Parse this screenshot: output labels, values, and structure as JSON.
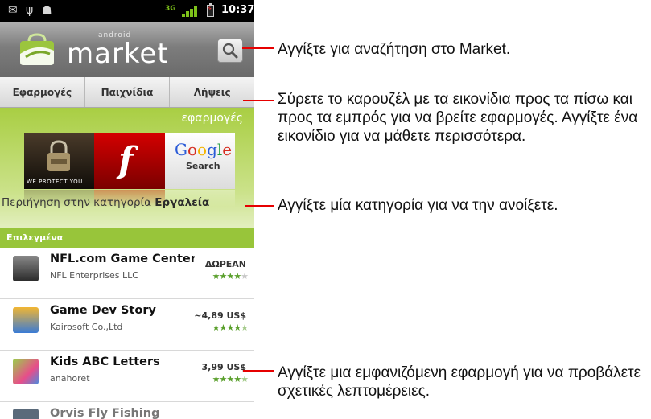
{
  "status_bar": {
    "time": "10:37",
    "network": "3G"
  },
  "header": {
    "logo_small": "android",
    "logo_word": "market"
  },
  "tabs": [
    {
      "label": "Εφαρμογές"
    },
    {
      "label": "Παιχνίδια"
    },
    {
      "label": "Λήψεις"
    }
  ],
  "featured": {
    "title": "εφαρμογές",
    "tile_1_caption": "WE PROTECT YOU.",
    "tile_3_google": "Google",
    "tile_3_search": "Search"
  },
  "browse": {
    "prefix": "Περιήγηση στην κατηγορία",
    "category": "Εργαλεία"
  },
  "section": {
    "title": "Επιλεγμένα"
  },
  "apps": [
    {
      "name": "NFL.com Game Center",
      "developer": "NFL Enterprises LLC",
      "price": "ΔΩΡΕΑΝ",
      "rating": 4
    },
    {
      "name": "Game Dev Story",
      "developer": "Kairosoft Co.,Ltd",
      "price": "~4,89 US$",
      "rating": 4.5
    },
    {
      "name": "Kids ABC Letters",
      "developer": "anahoret",
      "price": "3,99 US$",
      "rating": 4.5
    },
    {
      "name": "Orvis Fly Fishing",
      "developer": "",
      "price": "",
      "rating": 0
    }
  ],
  "callouts": [
    {
      "text": "Αγγίξτε για αναζήτηση στο Market."
    },
    {
      "text": "Σύρετε το καρουζέλ με τα εικονίδια προς τα πίσω και προς τα εμπρός για να βρείτε εφαρμογές. Αγγίξτε ένα εικονίδιο για να μάθετε περισσότερα."
    },
    {
      "text": "Αγγίξτε μία κατηγορία για να την ανοίξετε."
    },
    {
      "text": "Αγγίξτε μια εμφανιζόμενη εφαρμογή για να προβάλετε σχετικές λεπτομέρειες."
    }
  ],
  "colors": {
    "accent_green": "#98c53a",
    "callout_red": "#e60000",
    "header_gray": "#7d7d7d"
  },
  "icons": [
    "mail-icon",
    "usb-icon",
    "android-debug-icon",
    "signal-icon",
    "battery-icon",
    "search-icon",
    "market-bag-icon"
  ]
}
